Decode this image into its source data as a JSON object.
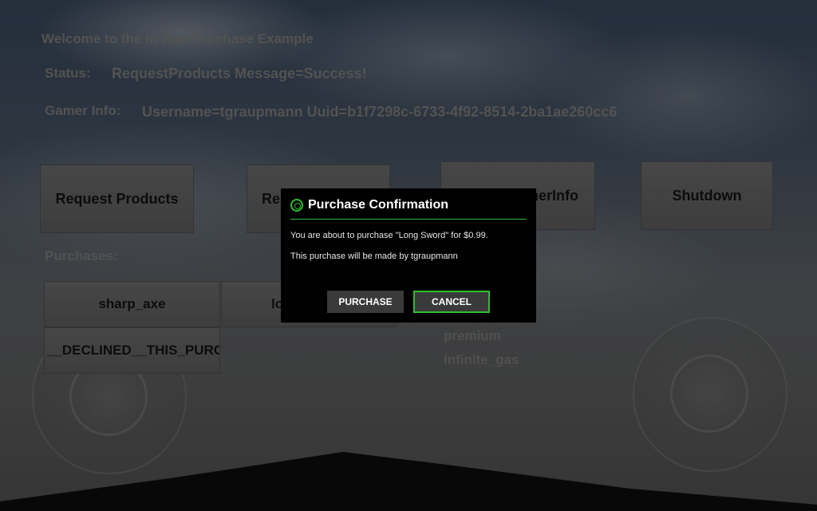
{
  "header": {
    "welcome": "Welcome to the In-App-Purchase Example",
    "status_label": "Status:",
    "status_value": "RequestProducts Message=Success!",
    "gamer_label": "Gamer Info:",
    "gamer_value": "Username=tgraupmann Uuid=b1f7298c-6733-4f92-8514-2ba1ae260cc6"
  },
  "buttons": {
    "request_products": "Request Products",
    "request_purchases_partial": "Re",
    "gamer_info_partial": "nerInfo",
    "shutdown": "Shutdown"
  },
  "purchases": {
    "label": "Purchases:",
    "items": [
      "sharp_axe",
      "__DECLINED__THIS_PURCH"
    ],
    "item_partial": "lo"
  },
  "products": [
    "premium",
    "infinite_gas"
  ],
  "dialog": {
    "title": "Purchase Confirmation",
    "message": "You are about to purchase \"Long Sword\" for $0.99.",
    "sub_message": "This purchase will be made by tgraupmann",
    "purchase_label": "PURCHASE",
    "cancel_label": "CANCEL",
    "accent_color": "#2fbf2f"
  }
}
